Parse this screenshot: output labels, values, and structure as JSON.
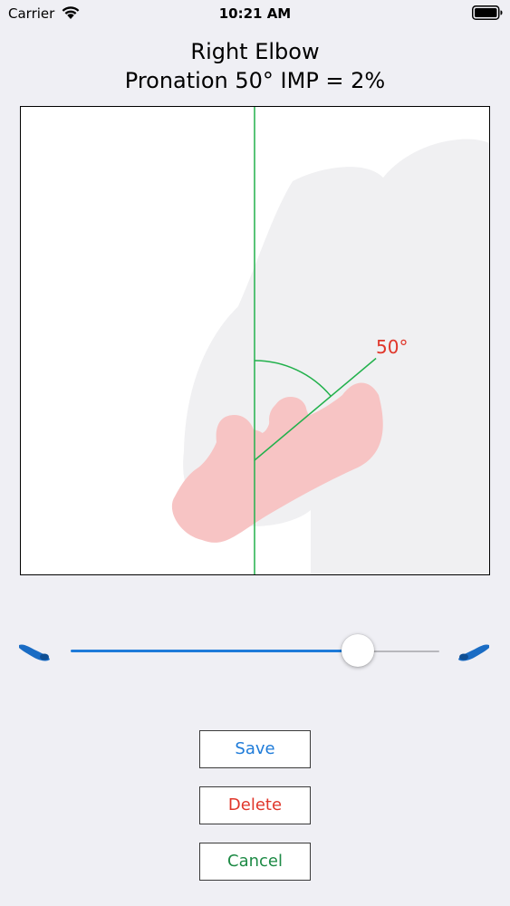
{
  "status_bar": {
    "carrier": "Carrier",
    "time": "10:21 AM",
    "icons": [
      "wifi-icon",
      "battery-icon"
    ]
  },
  "header": {
    "title": "Right Elbow",
    "subtitle": "Pronation 50° IMP = 2%"
  },
  "measurement": {
    "angle_label": "50°",
    "angle_degrees": 50,
    "colors": {
      "reference_line": "#22b14c",
      "angle_text": "#e0362a",
      "hand": "#f7c4c4",
      "arm_silhouette": "#f0f0f2"
    }
  },
  "slider": {
    "value_fraction": 0.78,
    "min_icon": "forearm-supination-icon",
    "max_icon": "forearm-pronation-icon",
    "fill_color": "#1e7bd9"
  },
  "buttons": {
    "save": "Save",
    "delete": "Delete",
    "cancel": "Cancel",
    "colors": {
      "save": "#1e7bd9",
      "delete": "#e0362a",
      "cancel": "#1d8a45"
    }
  }
}
